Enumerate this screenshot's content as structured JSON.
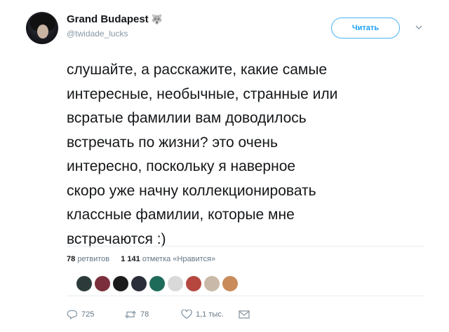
{
  "user": {
    "display_name": "Grand Budapest",
    "name_emoji": "🐺",
    "handle": "@twidade_lucks"
  },
  "follow_button": {
    "label": "Читать"
  },
  "tweet": {
    "lines": [
      "слушайте, а расскажите, какие самые",
      "интересные, необычные, странные или",
      "всратые фамилии вам доводилось",
      "встречать по жизни? это очень",
      "интересно, поскольку я наверное",
      "скоро уже начну коллекционировать",
      "классные фамилии, которые мне",
      "встречаются :)"
    ]
  },
  "stats": {
    "retweets_count": "78",
    "retweets_label": "ретвитов",
    "likes_count": "1 141",
    "likes_label": "отметка «Нравится»"
  },
  "likers": [
    {
      "color": "#2c3b3a"
    },
    {
      "color": "#7b2e3b"
    },
    {
      "color": "#1b1b1b"
    },
    {
      "color": "#2a2d3a"
    },
    {
      "color": "#1f6b5a"
    },
    {
      "color": "#d9d9d9"
    },
    {
      "color": "#b5473f"
    },
    {
      "color": "#c9b9a8"
    },
    {
      "color": "#c98b5a"
    }
  ],
  "actions": {
    "reply_count": "725",
    "retweet_count": "78",
    "like_count": "1,1 тыс.",
    "reply_icon": "reply-icon",
    "retweet_icon": "retweet-icon",
    "like_icon": "heart-icon",
    "dm_icon": "envelope-icon"
  },
  "colors": {
    "accent": "#1da1f2",
    "muted": "#657786"
  }
}
